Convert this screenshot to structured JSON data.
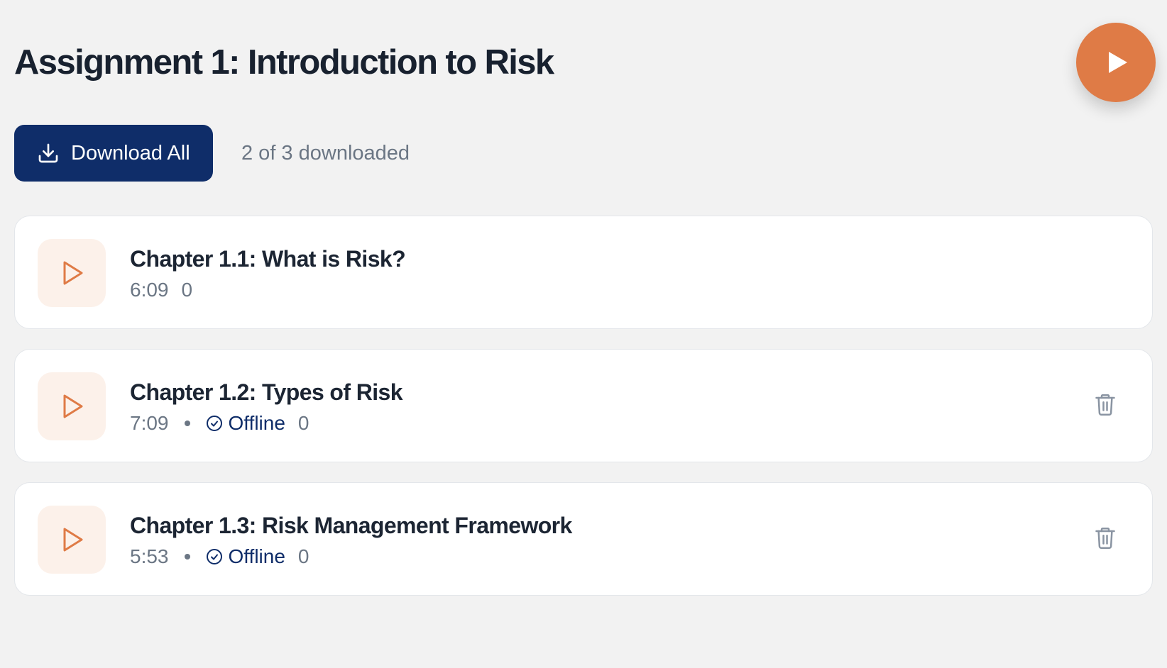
{
  "page": {
    "title": "Assignment 1: Introduction to Risk"
  },
  "fab": {
    "icon": "play-icon"
  },
  "toolbar": {
    "download_all_label": "Download All",
    "download_icon": "download-icon",
    "download_status": "2 of 3 downloaded"
  },
  "chapters": [
    {
      "title": "Chapter 1.1: What is Risk?",
      "duration": "6:09",
      "offline": false,
      "offline_label": "",
      "count": "0"
    },
    {
      "title": "Chapter 1.2: Types of Risk",
      "duration": "7:09",
      "offline": true,
      "offline_label": "Offline",
      "count": "0"
    },
    {
      "title": "Chapter 1.3: Risk Management Framework",
      "duration": "5:53",
      "offline": true,
      "offline_label": "Offline",
      "count": "0"
    }
  ],
  "colors": {
    "accent": "#df7b46",
    "primary": "#0f2d69",
    "background": "#f2f2f2",
    "card": "#ffffff",
    "muted_text": "#6b7684"
  }
}
